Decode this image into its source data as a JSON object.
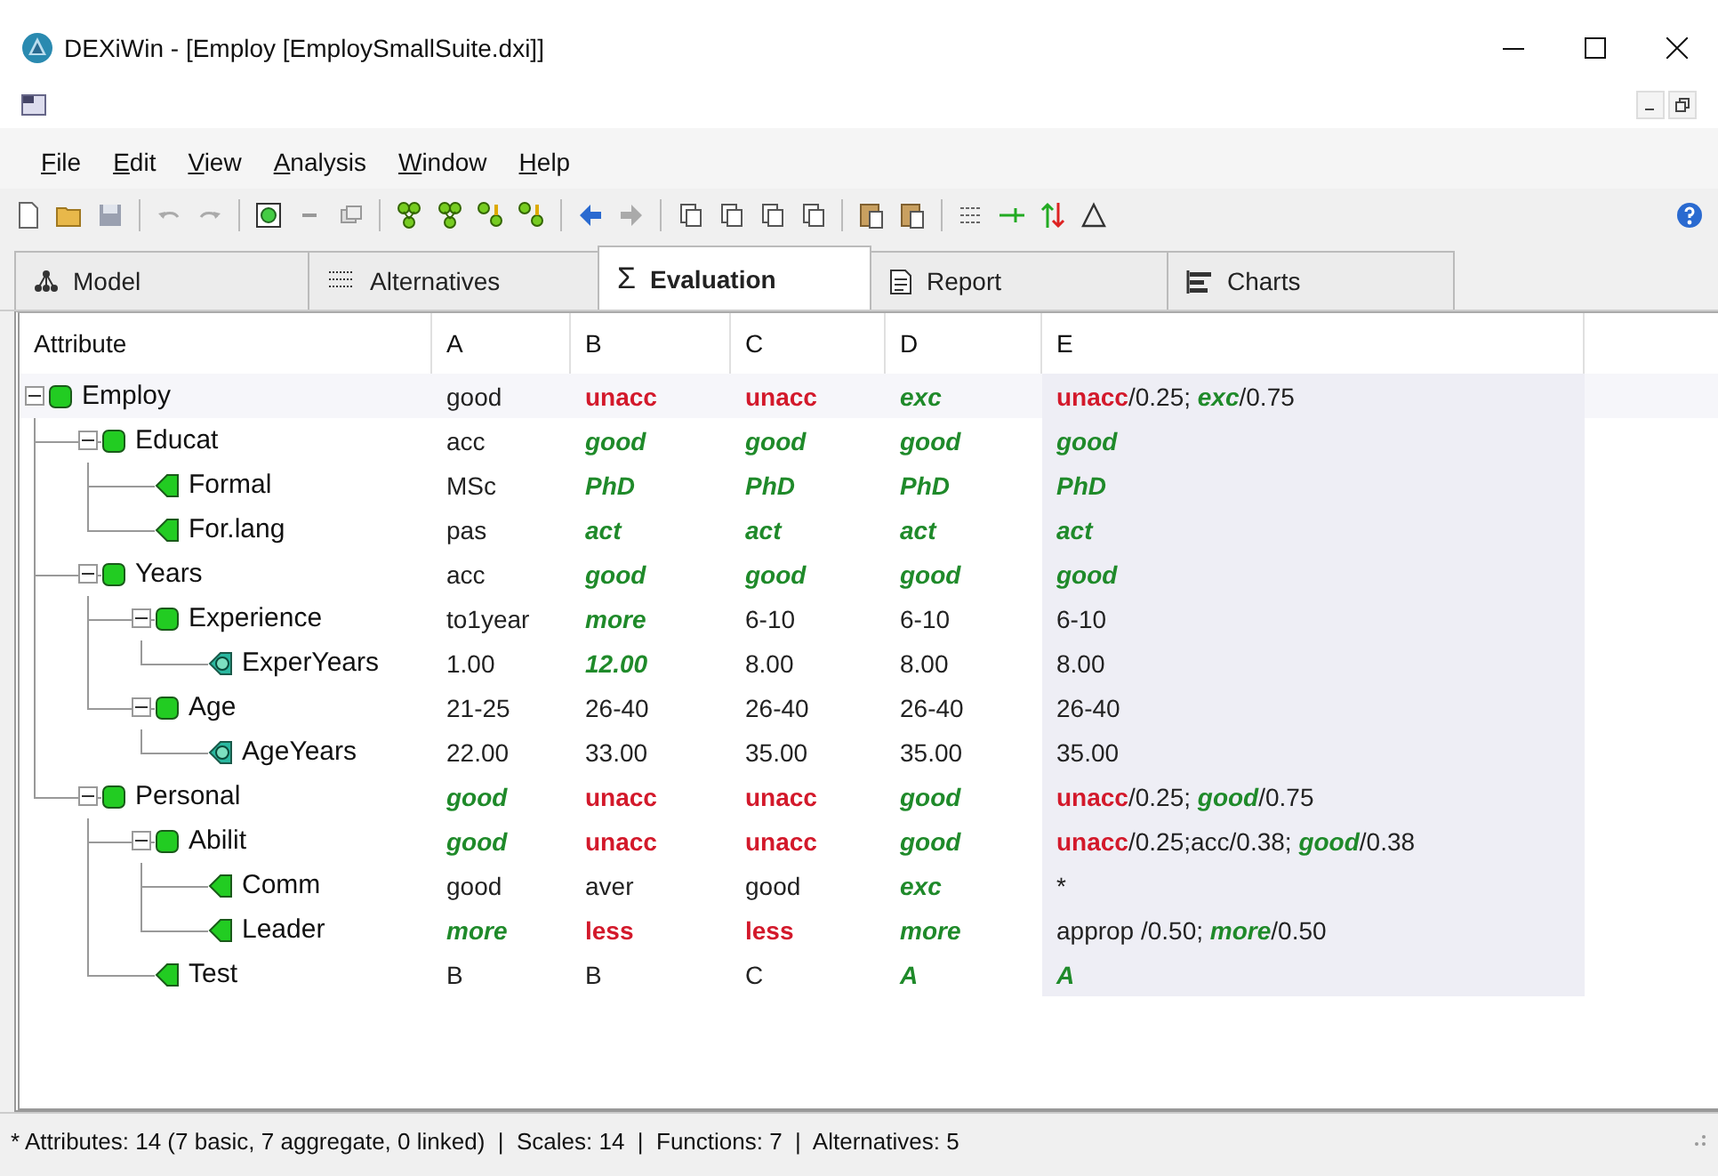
{
  "window": {
    "title": "DEXiWin - [Employ [EmploySmallSuite.dxi]]"
  },
  "menu": [
    {
      "label": "File"
    },
    {
      "label": "Edit"
    },
    {
      "label": "View"
    },
    {
      "label": "Analysis"
    },
    {
      "label": "Window"
    },
    {
      "label": "Help"
    }
  ],
  "tabs": [
    {
      "label": "Model",
      "kind": "model",
      "selected": false
    },
    {
      "label": "Alternatives",
      "kind": "alternatives",
      "selected": false
    },
    {
      "label": "Evaluation",
      "kind": "sum",
      "symbol": "Σ",
      "selected": true
    },
    {
      "label": "Report",
      "kind": "report",
      "selected": false
    },
    {
      "label": "Charts",
      "kind": "charts",
      "selected": false
    }
  ],
  "table": {
    "columns": [
      "Attribute",
      "A",
      "B",
      "C",
      "D",
      "E"
    ],
    "tree": [
      {
        "name": "Employ",
        "kind": "aggregate",
        "expanded": true,
        "cells": [
          [
            {
              "text": "good",
              "kind": "plain"
            }
          ],
          [
            {
              "text": "unacc",
              "kind": "bad"
            }
          ],
          [
            {
              "text": "unacc",
              "kind": "bad"
            }
          ],
          [
            {
              "text": "exc",
              "kind": "good"
            }
          ],
          [
            {
              "text": "unacc",
              "kind": "bad"
            },
            {
              "text": "/0.25; ",
              "kind": "plain"
            },
            {
              "text": "exc",
              "kind": "good"
            },
            {
              "text": "/0.75",
              "kind": "plain"
            }
          ]
        ],
        "children": [
          {
            "name": "Educat",
            "kind": "aggregate",
            "expanded": true,
            "cells": [
              [
                {
                  "text": "acc",
                  "kind": "plain"
                }
              ],
              [
                {
                  "text": "good",
                  "kind": "good"
                }
              ],
              [
                {
                  "text": "good",
                  "kind": "good"
                }
              ],
              [
                {
                  "text": "good",
                  "kind": "good"
                }
              ],
              [
                {
                  "text": "good",
                  "kind": "good"
                }
              ]
            ],
            "children": [
              {
                "name": "Formal",
                "kind": "basic",
                "cells": [
                  [
                    {
                      "text": "MSc",
                      "kind": "plain"
                    }
                  ],
                  [
                    {
                      "text": "PhD",
                      "kind": "good"
                    }
                  ],
                  [
                    {
                      "text": "PhD",
                      "kind": "good"
                    }
                  ],
                  [
                    {
                      "text": "PhD",
                      "kind": "good"
                    }
                  ],
                  [
                    {
                      "text": "PhD",
                      "kind": "good"
                    }
                  ]
                ]
              },
              {
                "name": "For.lang",
                "kind": "basic",
                "cells": [
                  [
                    {
                      "text": "pas",
                      "kind": "plain"
                    }
                  ],
                  [
                    {
                      "text": "act",
                      "kind": "good"
                    }
                  ],
                  [
                    {
                      "text": "act",
                      "kind": "good"
                    }
                  ],
                  [
                    {
                      "text": "act",
                      "kind": "good"
                    }
                  ],
                  [
                    {
                      "text": "act",
                      "kind": "good"
                    }
                  ]
                ]
              }
            ]
          },
          {
            "name": "Years",
            "kind": "aggregate",
            "expanded": true,
            "cells": [
              [
                {
                  "text": "acc",
                  "kind": "plain"
                }
              ],
              [
                {
                  "text": "good",
                  "kind": "good"
                }
              ],
              [
                {
                  "text": "good",
                  "kind": "good"
                }
              ],
              [
                {
                  "text": "good",
                  "kind": "good"
                }
              ],
              [
                {
                  "text": "good",
                  "kind": "good"
                }
              ]
            ],
            "children": [
              {
                "name": "Experience",
                "kind": "aggregate",
                "expanded": true,
                "cells": [
                  [
                    {
                      "text": "to1year",
                      "kind": "plain"
                    }
                  ],
                  [
                    {
                      "text": "more",
                      "kind": "good"
                    }
                  ],
                  [
                    {
                      "text": "6-10",
                      "kind": "plain"
                    }
                  ],
                  [
                    {
                      "text": "6-10",
                      "kind": "plain"
                    }
                  ],
                  [
                    {
                      "text": "6-10",
                      "kind": "plain"
                    }
                  ]
                ],
                "children": [
                  {
                    "name": "ExperYears",
                    "kind": "continuous",
                    "cells": [
                      [
                        {
                          "text": "1.00",
                          "kind": "plain"
                        }
                      ],
                      [
                        {
                          "text": "12.00",
                          "kind": "good"
                        }
                      ],
                      [
                        {
                          "text": "8.00",
                          "kind": "plain"
                        }
                      ],
                      [
                        {
                          "text": "8.00",
                          "kind": "plain"
                        }
                      ],
                      [
                        {
                          "text": "8.00",
                          "kind": "plain"
                        }
                      ]
                    ]
                  }
                ]
              },
              {
                "name": "Age",
                "kind": "aggregate",
                "expanded": true,
                "cells": [
                  [
                    {
                      "text": "21-25",
                      "kind": "plain"
                    }
                  ],
                  [
                    {
                      "text": "26-40",
                      "kind": "plain"
                    }
                  ],
                  [
                    {
                      "text": "26-40",
                      "kind": "plain"
                    }
                  ],
                  [
                    {
                      "text": "26-40",
                      "kind": "plain"
                    }
                  ],
                  [
                    {
                      "text": "26-40",
                      "kind": "plain"
                    }
                  ]
                ],
                "children": [
                  {
                    "name": "AgeYears",
                    "kind": "continuous",
                    "cells": [
                      [
                        {
                          "text": "22.00",
                          "kind": "plain"
                        }
                      ],
                      [
                        {
                          "text": "33.00",
                          "kind": "plain"
                        }
                      ],
                      [
                        {
                          "text": "35.00",
                          "kind": "plain"
                        }
                      ],
                      [
                        {
                          "text": "35.00",
                          "kind": "plain"
                        }
                      ],
                      [
                        {
                          "text": "35.00",
                          "kind": "plain"
                        }
                      ]
                    ]
                  }
                ]
              }
            ]
          },
          {
            "name": "Personal",
            "kind": "aggregate",
            "expanded": true,
            "cells": [
              [
                {
                  "text": "good",
                  "kind": "good"
                }
              ],
              [
                {
                  "text": "unacc",
                  "kind": "bad"
                }
              ],
              [
                {
                  "text": "unacc",
                  "kind": "bad"
                }
              ],
              [
                {
                  "text": "good",
                  "kind": "good"
                }
              ],
              [
                {
                  "text": "unacc",
                  "kind": "bad"
                },
                {
                  "text": "/0.25; ",
                  "kind": "plain"
                },
                {
                  "text": "good",
                  "kind": "good"
                },
                {
                  "text": "/0.75",
                  "kind": "plain"
                }
              ]
            ],
            "children": [
              {
                "name": "Abilit",
                "kind": "aggregate",
                "expanded": true,
                "cells": [
                  [
                    {
                      "text": "good",
                      "kind": "good"
                    }
                  ],
                  [
                    {
                      "text": "unacc",
                      "kind": "bad"
                    }
                  ],
                  [
                    {
                      "text": "unacc",
                      "kind": "bad"
                    }
                  ],
                  [
                    {
                      "text": "good",
                      "kind": "good"
                    }
                  ],
                  [
                    {
                      "text": "unacc",
                      "kind": "bad"
                    },
                    {
                      "text": "/0.25;acc/0.38; ",
                      "kind": "plain"
                    },
                    {
                      "text": "good",
                      "kind": "good"
                    },
                    {
                      "text": "/0.38",
                      "kind": "plain"
                    }
                  ]
                ],
                "children": [
                  {
                    "name": "Comm",
                    "kind": "basic",
                    "cells": [
                      [
                        {
                          "text": "good",
                          "kind": "plain"
                        }
                      ],
                      [
                        {
                          "text": "aver",
                          "kind": "plain"
                        }
                      ],
                      [
                        {
                          "text": "good",
                          "kind": "plain"
                        }
                      ],
                      [
                        {
                          "text": "exc",
                          "kind": "good"
                        }
                      ],
                      [
                        {
                          "text": "*",
                          "kind": "plain"
                        }
                      ]
                    ]
                  },
                  {
                    "name": "Leader",
                    "kind": "basic",
                    "cells": [
                      [
                        {
                          "text": "more",
                          "kind": "good"
                        }
                      ],
                      [
                        {
                          "text": "less",
                          "kind": "bad"
                        }
                      ],
                      [
                        {
                          "text": "less",
                          "kind": "bad"
                        }
                      ],
                      [
                        {
                          "text": "more",
                          "kind": "good"
                        }
                      ],
                      [
                        {
                          "text": "approp /0.50; ",
                          "kind": "plain"
                        },
                        {
                          "text": "more",
                          "kind": "good"
                        },
                        {
                          "text": "/0.50",
                          "kind": "plain"
                        }
                      ]
                    ]
                  }
                ]
              },
              {
                "name": "Test",
                "kind": "basic",
                "cells": [
                  [
                    {
                      "text": "B",
                      "kind": "plain"
                    }
                  ],
                  [
                    {
                      "text": "B",
                      "kind": "plain"
                    }
                  ],
                  [
                    {
                      "text": "C",
                      "kind": "plain"
                    }
                  ],
                  [
                    {
                      "text": "A",
                      "kind": "good"
                    }
                  ],
                  [
                    {
                      "text": "A",
                      "kind": "good"
                    }
                  ]
                ]
              }
            ]
          }
        ]
      }
    ]
  },
  "status_bar": "* Attributes: 14 (7 basic, 7 aggregate, 0 linked)  |  Scales: 14  |  Functions: 7  |  Alternatives: 5"
}
